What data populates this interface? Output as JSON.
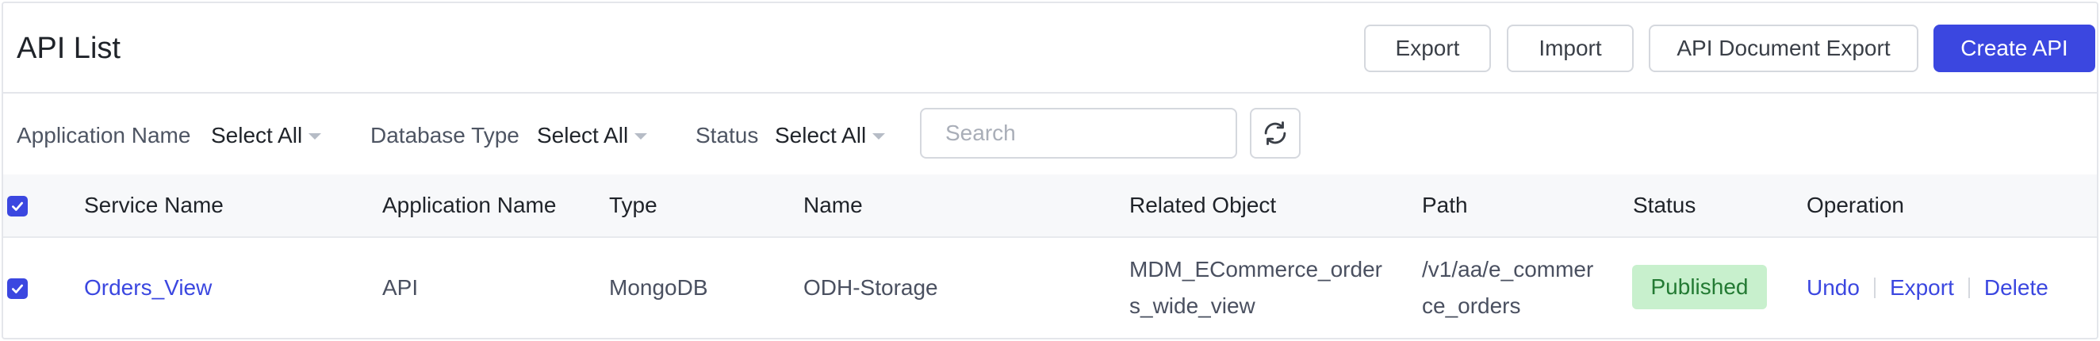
{
  "header": {
    "title": "API List",
    "buttons": {
      "export": "Export",
      "import": "Import",
      "doc_export": "API Document Export",
      "create": "Create API"
    }
  },
  "filters": {
    "application_name": {
      "label": "Application Name",
      "value": "Select All"
    },
    "database_type": {
      "label": "Database Type",
      "value": "Select All"
    },
    "status": {
      "label": "Status",
      "value": "Select All"
    },
    "search_placeholder": "Search",
    "refresh_icon": "refresh-icon"
  },
  "table": {
    "select_all_checked": true,
    "columns": {
      "service_name": "Service Name",
      "application_name": "Application Name",
      "type": "Type",
      "name": "Name",
      "related_object": "Related Object",
      "path": "Path",
      "status": "Status",
      "operation": "Operation"
    },
    "rows": [
      {
        "checked": true,
        "service_name": "Orders_View",
        "application_name": "API",
        "type": "MongoDB",
        "name": "ODH-Storage",
        "related_object_line1": "MDM_ECommerce_order",
        "related_object_line2": "s_wide_view",
        "path_line1": "/v1/aa/e_commer",
        "path_line2": "ce_orders",
        "status": "Published",
        "operations": {
          "undo": "Undo",
          "export": "Export",
          "delete": "Delete"
        }
      }
    ]
  },
  "colors": {
    "primary": "#3b47e0",
    "published_bg": "#c8f0cd",
    "published_text": "#237a33"
  }
}
